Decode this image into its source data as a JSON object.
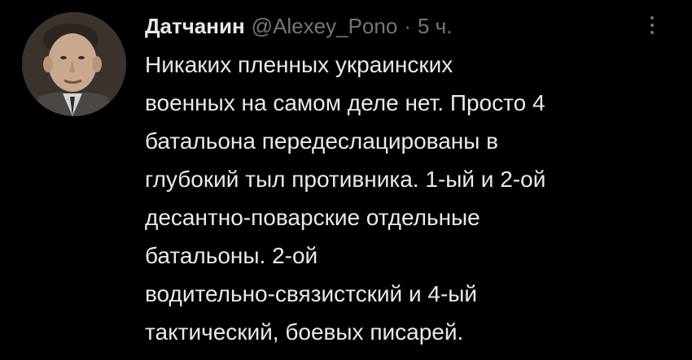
{
  "tweet": {
    "author_name": "Датчанин",
    "author_handle": "@Alexey_Pono",
    "separator": "·",
    "timestamp": "5 ч.",
    "body_lines": [
      "Никаких пленных украинских",
      "военных на самом деле нет. Просто 4",
      "батальона передеслацированы в",
      "глубокий тыл противника. 1-ый и 2-ой",
      "десантно-поварские отдельные",
      "батальоны. 2-ой",
      "водительно-связистский и 4-ый",
      "тактический, боевых писарей."
    ]
  },
  "icons": {
    "more": "more-options-icon",
    "avatar": "avatar"
  },
  "colors": {
    "background": "#000000",
    "primary_text": "#e7e9ea",
    "secondary_text": "#71767b"
  }
}
